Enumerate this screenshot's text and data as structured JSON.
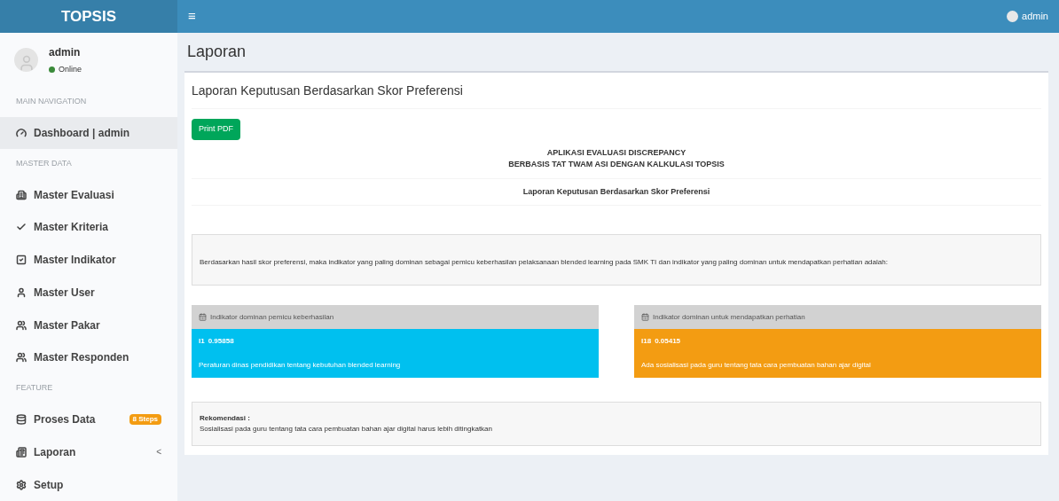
{
  "brand": "TOPSIS",
  "menu_toggle": "≡",
  "top_user": "admin",
  "user_panel": {
    "name": "admin",
    "status": "Online"
  },
  "sidebar": [
    {
      "kind": "header",
      "label": "MAIN NAVIGATION"
    },
    {
      "kind": "link",
      "label": "Dashboard | admin",
      "selected": true
    },
    {
      "kind": "header",
      "label": "MASTER DATA"
    },
    {
      "kind": "link",
      "label": "Master Evaluasi",
      "selected": false
    },
    {
      "kind": "link",
      "label": "Master Kriteria",
      "selected": false
    },
    {
      "kind": "link",
      "label": "Master Indikator",
      "selected": false
    },
    {
      "kind": "link",
      "label": "Master User",
      "selected": false
    },
    {
      "kind": "link",
      "label": "Master Pakar",
      "selected": false
    },
    {
      "kind": "link",
      "label": "Master Responden",
      "selected": false
    },
    {
      "kind": "header",
      "label": "FEATURE"
    },
    {
      "kind": "link",
      "label": "Proses Data",
      "selected": false,
      "badge": "8 Steps"
    },
    {
      "kind": "link",
      "label": "Laporan",
      "selected": false,
      "caret": "<"
    },
    {
      "kind": "link",
      "label": "Setup",
      "selected": false
    }
  ],
  "page_title": "Laporan",
  "box_title": "Laporan Keputusan Berdasarkan Skor Preferensi",
  "print_button": "Print PDF",
  "report_heading": [
    "APLIKASI EVALUASI DISCREPANCY",
    "BERBASIS TAT TWAM ASI DENGAN KALKULASI TOPSIS"
  ],
  "report_subheading": "Laporan Keputusan Berdasarkan Skor Preferensi",
  "summary": "Berdasarkan hasil skor preferensi, maka indikator yang paling dominan sebagai pemicu keberhasilan pelaksanaan blended learning pada SMK TI dan indikator yang paling dominan untuk mendapatkan perhatian adalah:",
  "indicators": [
    {
      "title": "Indikator dominan pemicu keberhasilan",
      "code": "I1",
      "score": "0.95858",
      "text": "Peraturan dinas pendidikan tentang kebutuhan blended learning",
      "color": "#00c0ef"
    },
    {
      "title": "Indikator dominan untuk mendapatkan perhatian",
      "code": "I18",
      "score": "0.05415",
      "text": "Ada sosialisasi pada guru tentang tata cara pembuatan bahan ajar digital",
      "color": "#f39c12"
    }
  ],
  "recommendation": {
    "label": "Rekomendasi :",
    "text": "Sosialisasi pada guru tentang tata cara pembuatan bahan ajar digital harus lebih ditingkatkan"
  }
}
